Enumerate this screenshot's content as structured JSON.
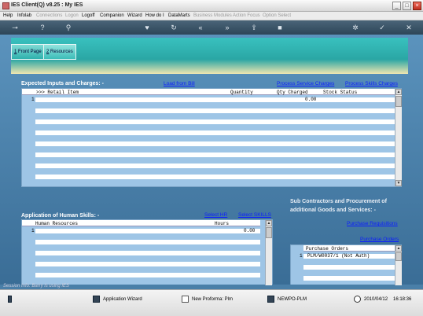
{
  "window": {
    "title": "IES Client(Q) v8.25 : My IES"
  },
  "menu": {
    "items": [
      {
        "label": "Help",
        "enabled": true
      },
      {
        "label": "Infolab",
        "enabled": true
      },
      {
        "label": "Connections",
        "enabled": false
      },
      {
        "label": "Logon",
        "enabled": false
      },
      {
        "label": "Logoff",
        "enabled": true
      },
      {
        "label": "Companion",
        "enabled": true
      },
      {
        "label": "Wizard",
        "enabled": true
      },
      {
        "label": "How do I",
        "enabled": true
      },
      {
        "label": "DataMarts",
        "enabled": true
      },
      {
        "label": "Business Modules",
        "enabled": false
      },
      {
        "label": "Action Focus",
        "enabled": false
      },
      {
        "label": "Option Select",
        "enabled": false
      }
    ]
  },
  "tabs": [
    {
      "num": "1",
      "label": " Front Page"
    },
    {
      "num": "2",
      "label": " Resources"
    }
  ],
  "inputs": {
    "title": "Expected Inputs and Charges: -",
    "load_from_bill": "Load from Bill",
    "process_service": "Process Service Charges",
    "process_skills": "Process Skills Charges",
    "columns": {
      "retail_item": ">>> Retail Item",
      "quantity": "Quantity",
      "qty_charged": "Qty Charged",
      "stock_status": "Stock Status"
    },
    "rows": [
      {
        "num": "1",
        "qty_charged": "0.00"
      }
    ]
  },
  "skills": {
    "title": "Application of Human Skills: -",
    "select_hr": "Select HR",
    "select_skills": "Select SKILLS",
    "columns": {
      "human_resources": "Human Resources",
      "hours": "Hours"
    },
    "rows": [
      {
        "num": "1",
        "hours": "0.00"
      }
    ]
  },
  "subcontractors": {
    "title_line1": "Sub Contractors and Procurement of",
    "title_line2": "additional Goods and Services: -",
    "purchase_requisitions": "Purchase Requisitions",
    "purchase_orders_link": "Purchase Orders",
    "column": "Purchase Orders",
    "rows": [
      {
        "num": "1",
        "value": "PLM/W0037/1 (Not Auth)"
      }
    ]
  },
  "session": "Session Info: Barry is using IES",
  "statusbar": {
    "wizard": "Application Wizard",
    "proforma": "New Proforma: Plm",
    "newpo": "NEWPO-PLM",
    "date": "2010/04/12",
    "time": "16:18:36"
  }
}
